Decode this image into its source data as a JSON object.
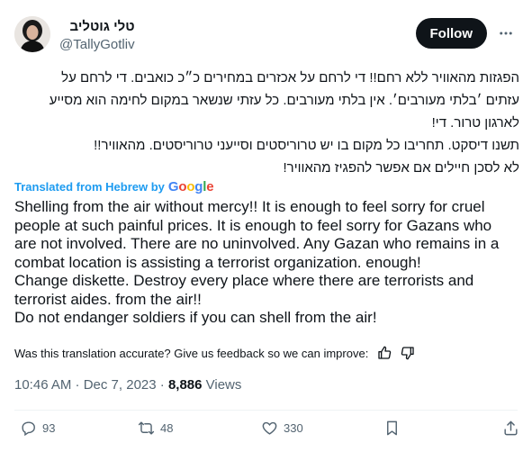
{
  "author": {
    "display_name": "טלי גוטליב",
    "handle": "@TallyGotliv"
  },
  "header": {
    "follow_label": "Follow"
  },
  "tweet": {
    "hebrew_lines": [
      "הפגזות מהאוויר ללא רחם!! די לרחם על אכזרים במחירים כ״כ כואבים. די לרחם על",
      "עזתים ׳בלתי מעורבים׳. אין בלתי מעורבים. כל עזתי שנשאר במקום לחימה הוא מסייע",
      "לארגון טרור. די!",
      "תשנו דיסקט. תחריבו כל מקום בו יש טרוריסטים וסייעני טרוריסטים. מהאוויר!!",
      "לא לסכן חיילים אם אפשר להפגיז מהאוויר!"
    ],
    "translated_from": "Translated from Hebrew by",
    "google_letters": [
      "G",
      "o",
      "o",
      "g",
      "l",
      "e"
    ],
    "english_lines": [
      "Shelling from the air without mercy!! It is enough to feel sorry for cruel",
      "people at such painful prices. It is enough to feel sorry for Gazans who",
      "are not involved. There are no uninvolved. Any Gazan who remains in a",
      "combat location is assisting a terrorist organization. enough!",
      "Change diskette. Destroy every place where there are terrorists and",
      "terrorist aides. from the air!!",
      "Do not endanger soldiers if you can shell from the air!"
    ],
    "feedback_prompt": "Was this translation accurate? Give us feedback so we can improve:",
    "timestamp": "10:46 AM · Dec 7, 2023 · ",
    "views_count": "8,886",
    "views_label": " Views"
  },
  "actions": {
    "replies": "93",
    "reposts": "48",
    "likes": "330"
  },
  "icons": {
    "more": "more-icon",
    "thumbs_up": "thumbs-up-icon",
    "thumbs_down": "thumbs-down-icon",
    "reply": "reply-icon",
    "repost": "repost-icon",
    "like": "heart-icon",
    "bookmark": "bookmark-icon",
    "share": "share-icon"
  },
  "colors": {
    "link_blue": "#1d9bf0",
    "text": "#0f1419",
    "muted": "#536471"
  }
}
